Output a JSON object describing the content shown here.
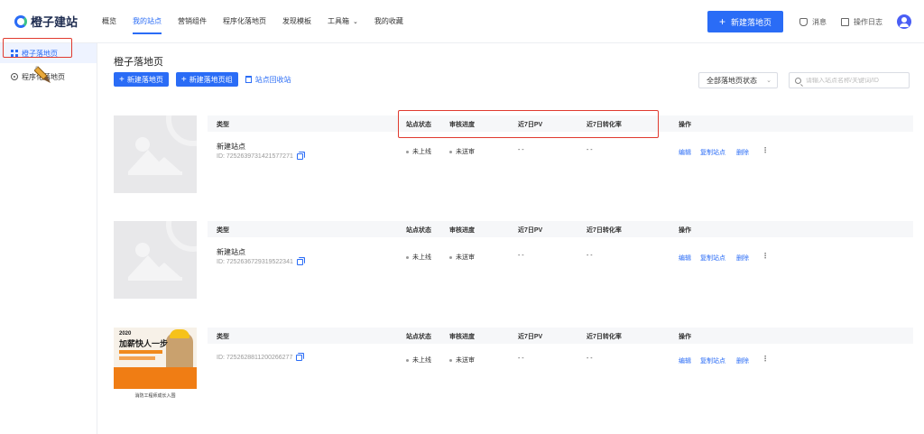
{
  "header": {
    "logo_text": "橙子建站",
    "nav": [
      {
        "label": "概览"
      },
      {
        "label": "我的站点"
      },
      {
        "label": "营销组件"
      },
      {
        "label": "程序化落地页"
      },
      {
        "label": "发现模板"
      },
      {
        "label": "工具箱"
      },
      {
        "label": "我的收藏"
      }
    ],
    "new_page_label": "新建落地页",
    "messages_label": "消息",
    "oplog_label": "操作日志"
  },
  "sidebar": {
    "items": [
      {
        "label": "橙子落地页"
      },
      {
        "label": "程序化落地页"
      }
    ]
  },
  "main": {
    "title": "橙子落地页",
    "new_page_btn": "新建落地页",
    "new_group_btn": "新建落地页组",
    "recycle_label": "站点回收站",
    "status_select": "全部落地页状态",
    "search_placeholder": "请输入站点名称/关键词/ID",
    "columns": {
      "type": "类型",
      "status": "站点状态",
      "review": "审核进度",
      "pv": "近7日PV",
      "cvr": "近7日转化率",
      "ops": "操作"
    },
    "rows": [
      {
        "name": "新建站点",
        "id": "ID: 7252639731421577271",
        "status": "未上线",
        "review": "未送审",
        "pv": "- -",
        "cvr": "- -"
      },
      {
        "name": "新建站点",
        "id": "ID: 7252636729319522341",
        "status": "未上线",
        "review": "未送审",
        "pv": "- -",
        "cvr": "- -"
      },
      {
        "name": "",
        "id": "ID: 7252628811200266277",
        "status": "未上线",
        "review": "未送审",
        "pv": "- -",
        "cvr": "- -"
      }
    ],
    "actions": {
      "edit": "编辑",
      "copy": "复制站点",
      "delete": "删除",
      "more": "⋮"
    },
    "promo": {
      "year": "2020",
      "title": "加薪快人一步",
      "footer": "消防工程师成长入围"
    }
  },
  "colors": {
    "accent": "#2a6cf6",
    "highlight": "#e03a2f"
  }
}
